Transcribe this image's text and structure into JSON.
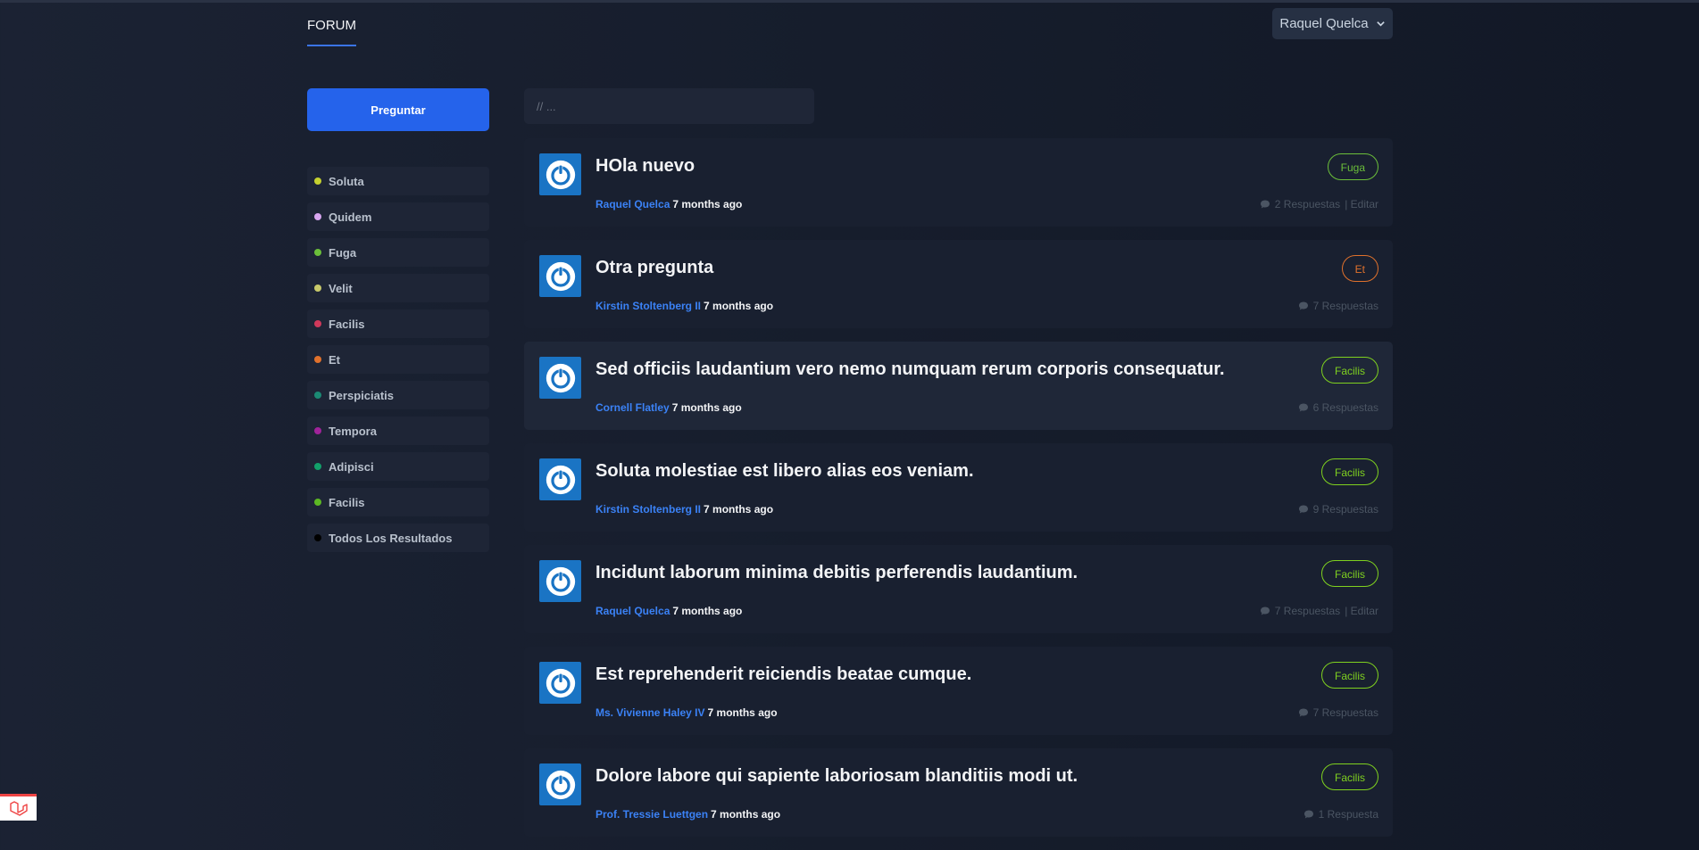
{
  "header": {
    "tab_label": "FORUM",
    "user_name": "Raquel Quelca"
  },
  "sidebar": {
    "ask_label": "Preguntar",
    "categories": [
      {
        "label": "Soluta",
        "color": "#c5d12f"
      },
      {
        "label": "Quidem",
        "color": "#d8a6f0"
      },
      {
        "label": "Fuga",
        "color": "#6bbf3a"
      },
      {
        "label": "Velit",
        "color": "#c8c96a"
      },
      {
        "label": "Facilis",
        "color": "#d0395b"
      },
      {
        "label": "Et",
        "color": "#e0712c"
      },
      {
        "label": "Perspiciatis",
        "color": "#1b8a74"
      },
      {
        "label": "Tempora",
        "color": "#a0239a"
      },
      {
        "label": "Adipisci",
        "color": "#12a06a"
      },
      {
        "label": "Facilis",
        "color": "#5cb823"
      },
      {
        "label": "Todos Los Resultados",
        "color": "#000000"
      }
    ]
  },
  "search": {
    "placeholder": "// ..."
  },
  "threads": [
    {
      "title": "HOla nuevo",
      "author": "Raquel Quelca",
      "time": "7 months ago",
      "tag": "Fuga",
      "tag_color": "#6bbf3a",
      "replies": "2 Respuestas",
      "edit": "| Editar"
    },
    {
      "title": "Otra pregunta",
      "author": "Kirstin Stoltenberg II",
      "time": "7 months ago",
      "tag": "Et",
      "tag_color": "#e0712c",
      "replies": "7 Respuestas",
      "edit": ""
    },
    {
      "title": "Sed officiis laudantium vero nemo numquam rerum corporis consequatur.",
      "author": "Cornell Flatley",
      "time": "7 months ago",
      "tag": "Facilis",
      "tag_color": "#7fd11f",
      "replies": "6 Respuestas",
      "edit": ""
    },
    {
      "title": "Soluta molestiae est libero alias eos veniam.",
      "author": "Kirstin Stoltenberg II",
      "time": "7 months ago",
      "tag": "Facilis",
      "tag_color": "#7fd11f",
      "replies": "9 Respuestas",
      "edit": ""
    },
    {
      "title": "Incidunt laborum minima debitis perferendis laudantium.",
      "author": "Raquel Quelca",
      "time": "7 months ago",
      "tag": "Facilis",
      "tag_color": "#7fd11f",
      "replies": "7 Respuestas",
      "edit": "| Editar"
    },
    {
      "title": "Est reprehenderit reiciendis beatae cumque.",
      "author": "Ms. Vivienne Haley IV",
      "time": "7 months ago",
      "tag": "Facilis",
      "tag_color": "#7fd11f",
      "replies": "7 Respuestas",
      "edit": ""
    },
    {
      "title": "Dolore labore qui sapiente laboriosam blanditiis modi ut.",
      "author": "Prof. Tressie Luettgen",
      "time": "7 months ago",
      "tag": "Facilis",
      "tag_color": "#7fd11f",
      "replies": "1 Respuesta",
      "edit": ""
    }
  ]
}
